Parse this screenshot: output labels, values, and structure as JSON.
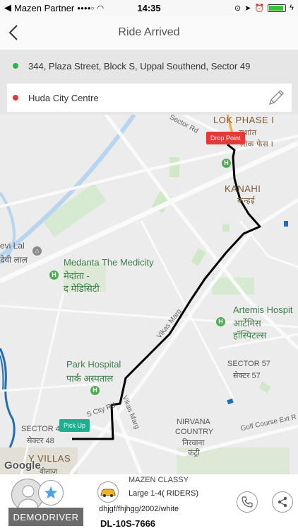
{
  "status_bar": {
    "carrier": "Mazen Partner",
    "signal": "●●●●○",
    "time": "14:35"
  },
  "header": {
    "title": "Ride Arrived",
    "back_icon": "chevron-left-icon"
  },
  "locations": {
    "pickup": "344, Plaza Street, Block S, Uppal Southend, Sector 49",
    "drop": "Huda City Centre",
    "edit_icon": "pencil-icon"
  },
  "map": {
    "labels": {
      "lok_phase": "LOK PHASE I",
      "lok_hindi": "लोक फेस I",
      "sushant": "सुशांत",
      "kanahi": "KANAHI",
      "kanahi_hindi": "कन्हई",
      "devi_lal": "evi Lal",
      "devi_lal_hindi": "देवी लाल",
      "medanta": "Medanta The Medicity",
      "medanta_hindi1": "मेदांता -",
      "medanta_hindi2": "द मेडिसिटी",
      "artemis": "Artemis Hospit",
      "artemis_hindi1": "आर्टेमिस",
      "artemis_hindi2": "हॉस्पिटल्स",
      "park": "Park Hospital",
      "park_hindi": "पार्क अस्पताल",
      "sector57": "SECTOR 57",
      "sector57_hindi": "सेक्टर 57",
      "sector48": "SECTOR 48",
      "sector48_hindi": "सेक्टर 48",
      "nirvana1": "NIRVANA",
      "nirvana2": "COUNTRY",
      "nirvana_hindi1": "निरवाना",
      "nirvana_hindi2": "कंट्री",
      "villas": "Y VILLAS",
      "villas_hindi": "वीलाज़",
      "vikas_marg": "Vikas Marg",
      "vikas_marg2": "Vikas Marg",
      "sector_rd": "Sector Rd",
      "golf_course": "Golf Course Ext R",
      "s_city_rd": "S City Rd"
    },
    "drop_pin": "Drop Point",
    "pickup_pin": "Pick Up",
    "attribution": "Google"
  },
  "driver": {
    "name": "DEMODRIVER",
    "avatar_icon": "user-avatar-icon",
    "badge_icon": "star-icon"
  },
  "vehicle": {
    "class": "MAZEN CLASSY",
    "capacity": "Large 1-4( RIDERS)",
    "details": "dhjgf/fhjhgg/2002/white",
    "plate": "DL-10S-7666",
    "car_icon": "car-icon"
  },
  "actions": {
    "call_icon": "phone-icon",
    "share_icon": "share-icon"
  },
  "colors": {
    "pickup_dot": "#2db34a",
    "drop_dot": "#e53935",
    "drop_pin": "#e53935",
    "pickup_pin": "#1fae8f",
    "route": "#000000"
  }
}
